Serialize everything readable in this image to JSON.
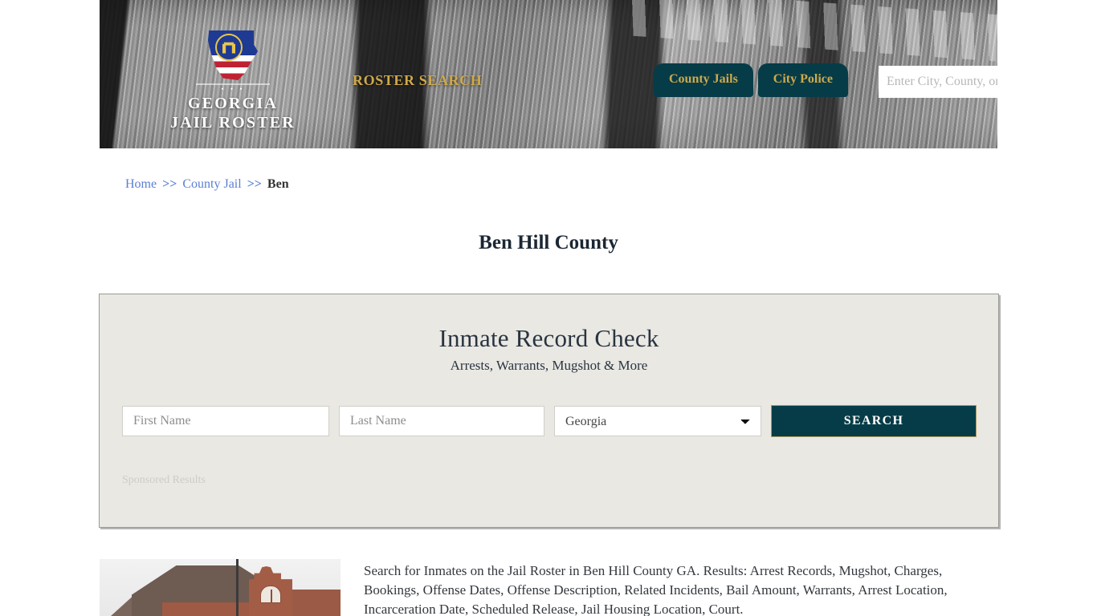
{
  "site": {
    "logo": {
      "line1": "GEORGIA",
      "line2": "JAIL ROSTER",
      "dots": "• • •"
    },
    "tagline": "ROSTER SEARCH"
  },
  "nav": {
    "items": [
      {
        "label": "County Jails"
      },
      {
        "label": "City Police"
      }
    ]
  },
  "header_search": {
    "placeholder": "Enter City, County, or Facil",
    "value": ""
  },
  "breadcrumb": {
    "items": [
      {
        "label": "Home",
        "link": true
      },
      {
        "label": "County Jail",
        "link": true
      },
      {
        "label": "Ben",
        "link": false
      }
    ],
    "separator": ">>"
  },
  "page": {
    "title": "Ben Hill County"
  },
  "inmate_check": {
    "title": "Inmate Record Check",
    "subtitle": "Arrests, Warrants, Mugshot & More",
    "first_name": {
      "placeholder": "First Name",
      "value": ""
    },
    "last_name": {
      "placeholder": "Last Name",
      "value": ""
    },
    "state": {
      "selected": "Georgia",
      "options": [
        "Georgia"
      ]
    },
    "search_label": "SEARCH",
    "sponsored_label": "Sponsored Results"
  },
  "description": {
    "text": "Search for Inmates on the Jail Roster in Ben Hill County GA. Results: Arrest Records, Mugshot, Charges, Bookings, Offense Dates, Offense Description, Related Incidents, Bail Amount, Warrants, Arrest Location, Incarceration Date, Scheduled Release, Jail Housing Location, Court."
  },
  "colors": {
    "teal": "#063c47",
    "gold": "#cfa94b",
    "box_bg": "#e9e8e3",
    "link": "#5a7fd4"
  },
  "icons": {
    "search": "search-icon",
    "dropdown": "chevron-down-icon"
  }
}
